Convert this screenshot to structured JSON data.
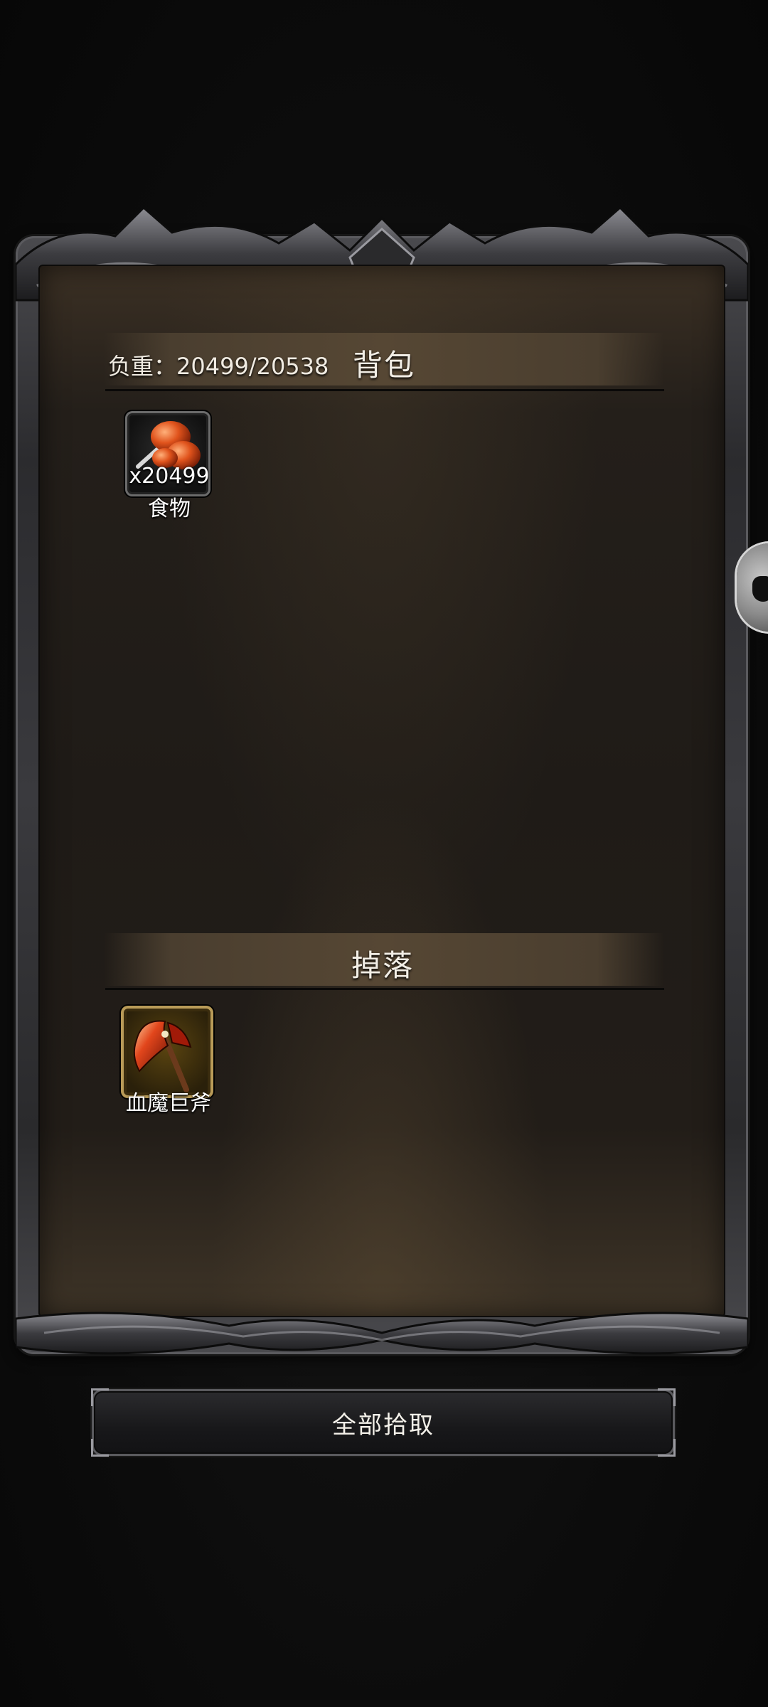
{
  "backpack": {
    "title": "背包",
    "weight_label": "负重：20499/20538",
    "items": [
      {
        "name": "食物",
        "quantity": "x20499",
        "icon": "food-item-icon"
      }
    ]
  },
  "drops": {
    "title": "掉落",
    "items": [
      {
        "name": "血魔巨斧",
        "icon": "axe-item-icon"
      }
    ]
  },
  "actions": {
    "pick_all_label": "全部拾取"
  },
  "colors": {
    "panel_brown": "#221d18",
    "bar_brown": "#564734",
    "frame_metal": "#3a3a3e",
    "text": "#f2eee6"
  }
}
